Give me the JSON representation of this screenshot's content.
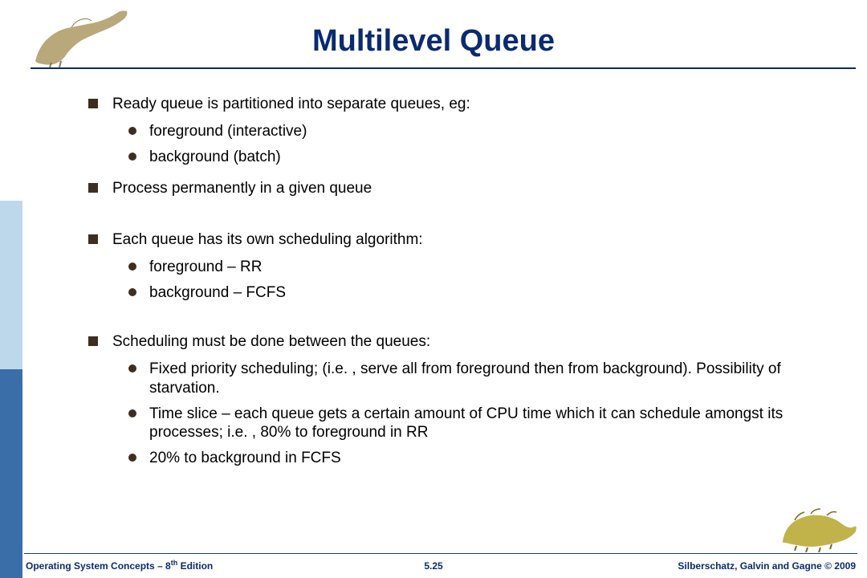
{
  "title": "Multilevel Queue",
  "bullets": [
    {
      "text": "Ready queue is partitioned into separate queues, eg:",
      "sub": [
        "foreground (interactive)",
        "background (batch)"
      ]
    },
    {
      "text": "Process permanently in a given queue",
      "sub": [],
      "gapAfter": "md"
    },
    {
      "text": "Each queue has its own scheduling algorithm:",
      "sub": [
        "foreground – RR",
        "background – FCFS"
      ],
      "gapAfter": "md"
    },
    {
      "text": "Scheduling must be done between the queues:",
      "sub": [
        "Fixed priority scheduling; (i.e. , serve all from foreground then from background).  Possibility of starvation.",
        "Time slice – each queue gets a certain amount of CPU time which it can schedule amongst its processes; i.e. , 80% to foreground in RR",
        "20% to background in FCFS"
      ]
    }
  ],
  "footer": {
    "left_a": "Operating System Concepts – 8",
    "left_sup": "th",
    "left_b": " Edition",
    "center": "5.25",
    "right": "Silberschatz, Galvin and Gagne © 2009"
  }
}
